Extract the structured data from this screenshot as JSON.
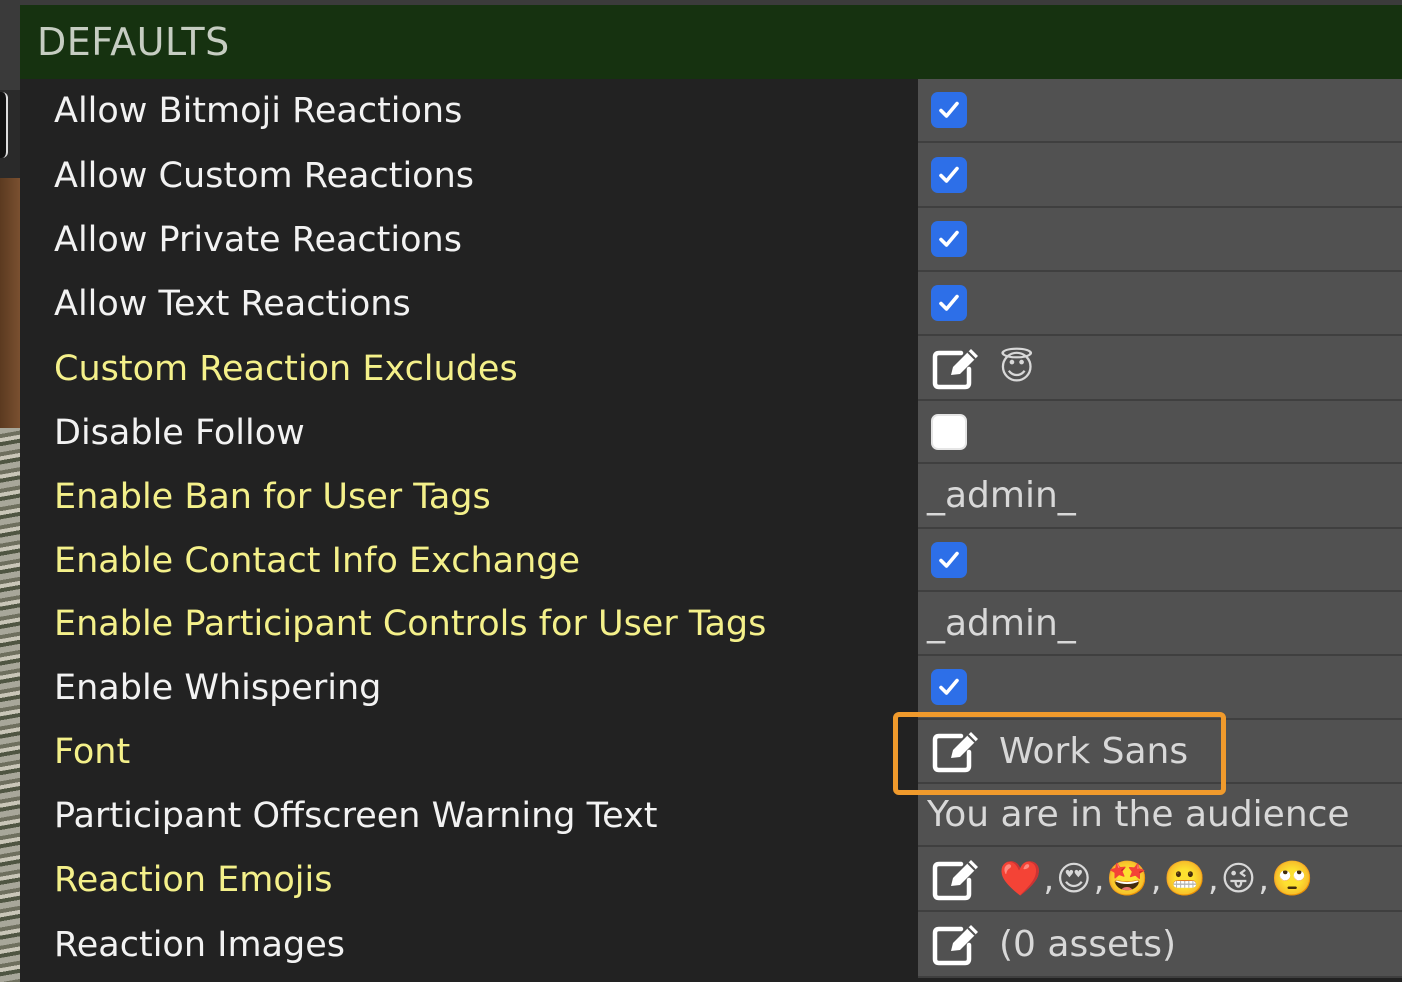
{
  "header": {
    "title": "DEFAULTS"
  },
  "rows": [
    {
      "label": "Allow Bitmoji Reactions",
      "kind": "checkbox",
      "checked": true
    },
    {
      "label": "Allow Custom Reactions",
      "kind": "checkbox",
      "checked": true
    },
    {
      "label": "Allow Private Reactions",
      "kind": "checkbox",
      "checked": true
    },
    {
      "label": "Allow Text Reactions",
      "kind": "checkbox",
      "checked": true
    },
    {
      "label": "Custom Reaction Excludes",
      "kind": "edit",
      "value": "😇"
    },
    {
      "label": "Disable Follow",
      "kind": "checkbox",
      "checked": false
    },
    {
      "label": "Enable Ban for User Tags",
      "kind": "text",
      "value": "_admin_"
    },
    {
      "label": "Enable Contact Info Exchange",
      "kind": "checkbox",
      "checked": true
    },
    {
      "label": "Enable Participant Controls for User Tags",
      "kind": "text",
      "value": "_admin_"
    },
    {
      "label": "Enable Whispering",
      "kind": "checkbox",
      "checked": true
    },
    {
      "label": "Font",
      "kind": "edit",
      "value": "Work Sans"
    },
    {
      "label": "Participant Offscreen Warning Text",
      "kind": "text",
      "value": "You are in the audience"
    },
    {
      "label": "Reaction Emojis",
      "kind": "edit",
      "emojis": [
        "❤️",
        "😍",
        "🤩",
        "😬",
        "😜",
        "🙄"
      ]
    },
    {
      "label": "Reaction Images",
      "kind": "edit",
      "value": "(0 assets)"
    }
  ],
  "colors": {
    "header_bg": "#163210",
    "link_label": "#f4f08a",
    "checkbox": "#2d6fe8",
    "highlight": "#f09a2c"
  },
  "icons": {
    "edit": "edit-square-pencil-icon",
    "check": "checkmark-icon"
  }
}
